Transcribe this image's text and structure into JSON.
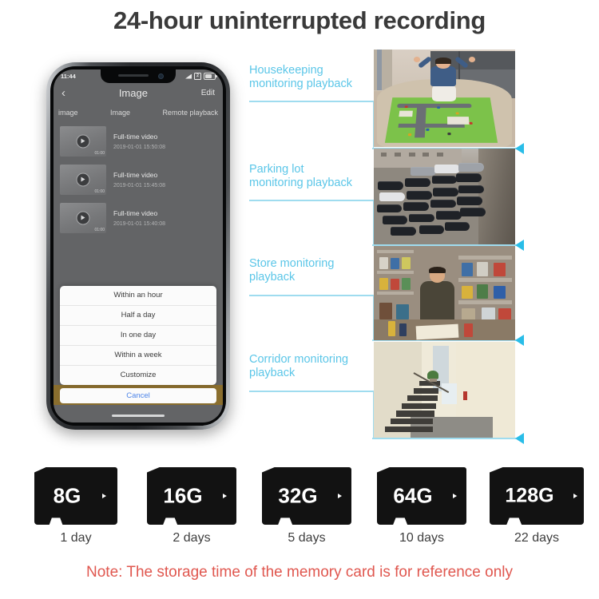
{
  "page": {
    "title": "24-hour uninterrupted recording",
    "note": "Note: The storage time of the memory card is for reference only",
    "accent_cyan": "#5bc6e8",
    "connector_color": "#9fdcef",
    "arrow_color": "#29bde8",
    "note_color": "#e0574f",
    "title_color": "#3a3a3a"
  },
  "phone": {
    "status_bar": {
      "time": "11:44",
      "signal_icon": "signal-icon",
      "sim_icon": "sim-card-icon",
      "battery_icon": "battery-icon"
    },
    "nav": {
      "back_icon": "chevron-left-icon",
      "title": "Image",
      "edit_label": "Edit"
    },
    "tabs": [
      {
        "label": "image"
      },
      {
        "label": "Image"
      },
      {
        "label": "Remote playback"
      }
    ],
    "videos": [
      {
        "title": "Full-time video",
        "timestamp": "2019-01-01 15:50:08",
        "duration": "01:00",
        "play_icon": "play-circle-icon"
      },
      {
        "title": "Full-time video",
        "timestamp": "2019-01-01 15:45:08",
        "duration": "01:00",
        "play_icon": "play-circle-icon"
      },
      {
        "title": "Full-time video",
        "timestamp": "2019-01-01 15:40:08",
        "duration": "01:00",
        "play_icon": "play-circle-icon"
      }
    ],
    "action_sheet": {
      "options": [
        {
          "label": "Within an hour"
        },
        {
          "label": "Half a day"
        },
        {
          "label": "In one day"
        },
        {
          "label": "Within a week"
        },
        {
          "label": "Customize"
        }
      ],
      "cancel_label": "Cancel"
    },
    "home_indicator": "home-indicator"
  },
  "annotations": [
    {
      "label": "Housekeeping\nmonitoring playback",
      "photo_name": "housekeeping-playback-photo",
      "photo_description": "Child sitting on a play mat rug in a living room with a grey sofa"
    },
    {
      "label": "Parking lot\nmonitoring playback",
      "photo_name": "parking-lot-playback-photo",
      "photo_description": "Aerial view of a parking lot filled with rows of dark cars"
    },
    {
      "label": "Store monitoring\nplayback",
      "photo_name": "store-playback-photo",
      "photo_description": "Shopkeeper standing behind a counter in a crowded convenience store"
    },
    {
      "label": "Corridor monitoring\nplayback",
      "photo_name": "corridor-playback-photo",
      "photo_description": "Indoor corridor with a concrete staircase and a potted plant"
    }
  ],
  "memory_cards": [
    {
      "capacity": "8G",
      "days": "1 day"
    },
    {
      "capacity": "16G",
      "days": "2 days"
    },
    {
      "capacity": "32G",
      "days": "5 days"
    },
    {
      "capacity": "64G",
      "days": "10 days"
    },
    {
      "capacity": "128G",
      "days": "22 days"
    }
  ]
}
